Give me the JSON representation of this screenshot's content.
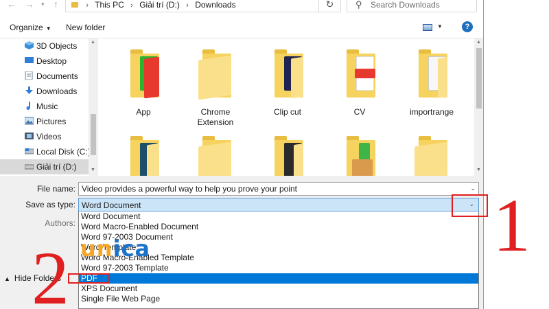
{
  "address": {
    "crumbs": [
      "This PC",
      "Giải trí (D:)",
      "Downloads"
    ]
  },
  "search": {
    "placeholder": "Search Downloads"
  },
  "toolbar": {
    "organize_label": "Organize",
    "new_folder_label": "New folder",
    "help_label": "?"
  },
  "sidebar": {
    "items": [
      {
        "label": "3D Objects",
        "icon": "cube-icon"
      },
      {
        "label": "Desktop",
        "icon": "desktop-icon"
      },
      {
        "label": "Documents",
        "icon": "document-icon"
      },
      {
        "label": "Downloads",
        "icon": "download-arrow-icon"
      },
      {
        "label": "Music",
        "icon": "music-note-icon"
      },
      {
        "label": "Pictures",
        "icon": "picture-icon"
      },
      {
        "label": "Videos",
        "icon": "film-icon"
      },
      {
        "label": "Local Disk (C:)",
        "icon": "drive-icon"
      },
      {
        "label": "Giải trí (D:)",
        "icon": "drive-icon"
      }
    ],
    "selected": "Giải trí (D:)"
  },
  "files": [
    {
      "name": "App",
      "icon": "folder-app-icon"
    },
    {
      "name": "Chrome Extension",
      "icon": "folder-icon"
    },
    {
      "name": "Clip cut",
      "icon": "folder-clip-icon"
    },
    {
      "name": "CV",
      "icon": "folder-pdf-icon"
    },
    {
      "name": "importrange",
      "icon": "folder-doc-icon"
    },
    {
      "name": "",
      "icon": "folder-icon"
    },
    {
      "name": "",
      "icon": "folder-icon"
    },
    {
      "name": "",
      "icon": "folder-icon"
    },
    {
      "name": "",
      "icon": "folder-icon"
    },
    {
      "name": "",
      "icon": "folder-icon"
    }
  ],
  "form": {
    "file_name_label": "File name:",
    "file_name_value": "Video provides a powerful way to help you prove your point",
    "save_as_type_label": "Save as type:",
    "save_as_type_value": "Word Document",
    "authors_label": "Authors:"
  },
  "save_type_options": [
    "Word Document",
    "Word Macro-Enabled Document",
    "Word 97-2003 Document",
    "Word Template",
    "Word Macro-Enabled Template",
    "Word 97-2003 Template",
    "PDF",
    "XPS Document",
    "Single File Web Page"
  ],
  "highlighted_option": "PDF",
  "hide_folders_label": "Hide Folders",
  "annotations": {
    "step1": "1",
    "step2": "2"
  },
  "watermark": {
    "left": "un",
    "right": "ica"
  },
  "colors": {
    "highlight": "#0078d7",
    "annotation": "#e02020",
    "watermark_orange": "#f5a623",
    "watermark_blue": "#1a73c9"
  }
}
